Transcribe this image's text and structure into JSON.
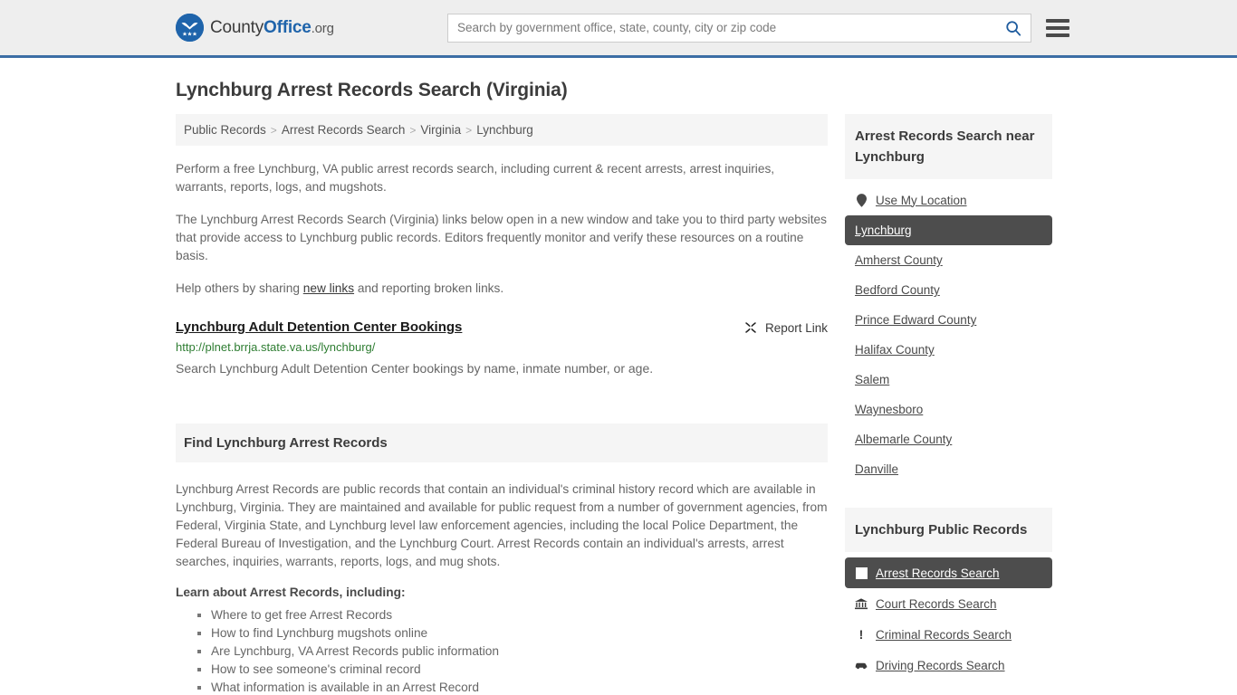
{
  "header": {
    "logo_text_1": "County",
    "logo_text_2": "Office",
    "logo_text_3": ".org",
    "logo_icon": "eagle-stars-seal-icon",
    "search_placeholder": "Search by government office, state, county, city or zip code",
    "search_value": "",
    "search_icon": "search-icon",
    "menu_icon": "hamburger-menu-icon",
    "accent_color": "#3c6ea5"
  },
  "page": {
    "title": "Lynchburg Arrest Records Search (Virginia)"
  },
  "breadcrumb": {
    "items": [
      {
        "label": "Public Records"
      },
      {
        "label": "Arrest Records Search"
      },
      {
        "label": "Virginia"
      },
      {
        "label": "Lynchburg"
      }
    ],
    "separator": ">"
  },
  "intro": {
    "p1": "Perform a free Lynchburg, VA public arrest records search, including current & recent arrests, arrest inquiries, warrants, reports, logs, and mugshots.",
    "p2": "The Lynchburg Arrest Records Search (Virginia) links below open in a new window and take you to third party websites that provide access to Lynchburg public records. Editors frequently monitor and verify these resources on a routine basis.",
    "p3_before": "Help others by sharing ",
    "p3_link": "new links",
    "p3_after": " and reporting broken links."
  },
  "result": {
    "title": "Lynchburg Adult Detention Center Bookings",
    "url": "http://plnet.brrja.state.va.us/lynchburg/",
    "description": "Search Lynchburg Adult Detention Center bookings by name, inmate number, or age.",
    "report_label": "Report Link",
    "report_icon": "broken-link-icon"
  },
  "find_section": {
    "heading": "Find Lynchburg Arrest Records",
    "body": "Lynchburg Arrest Records are public records that contain an individual's criminal history record which are available in Lynchburg, Virginia. They are maintained and available for public request from a number of government agencies, from Federal, Virginia State, and Lynchburg level law enforcement agencies, including the local Police Department, the Federal Bureau of Investigation, and the Lynchburg Court. Arrest Records contain an individual's arrests, arrest searches, inquiries, warrants, reports, logs, and mug shots.",
    "learn_heading": "Learn about Arrest Records, including:",
    "topics": [
      "Where to get free Arrest Records",
      "How to find Lynchburg mugshots online",
      "Are Lynchburg, VA Arrest Records public information",
      "How to see someone's criminal record",
      "What information is available in an Arrest Record"
    ]
  },
  "sidebar": {
    "nearby_heading": "Arrest Records Search near Lynchburg",
    "use_my_location": {
      "label": "Use My Location",
      "icon": "map-pin-icon"
    },
    "nearby_items": [
      {
        "label": "Lynchburg",
        "active": true
      },
      {
        "label": "Amherst County",
        "active": false
      },
      {
        "label": "Bedford County",
        "active": false
      },
      {
        "label": "Prince Edward County",
        "active": false
      },
      {
        "label": "Halifax County",
        "active": false
      },
      {
        "label": "Salem",
        "active": false
      },
      {
        "label": "Waynesboro",
        "active": false
      },
      {
        "label": "Albemarle County",
        "active": false
      },
      {
        "label": "Danville",
        "active": false
      }
    ],
    "records_heading": "Lynchburg Public Records",
    "records_items": [
      {
        "label": "Arrest Records Search",
        "icon": "white-square-icon",
        "active": true
      },
      {
        "label": "Court Records Search",
        "icon": "courthouse-icon",
        "active": false
      },
      {
        "label": "Criminal Records Search",
        "icon": "exclamation-icon",
        "active": false
      },
      {
        "label": "Driving Records Search",
        "icon": "car-icon",
        "active": false
      }
    ],
    "active_bg_color": "#4d4d4d"
  }
}
